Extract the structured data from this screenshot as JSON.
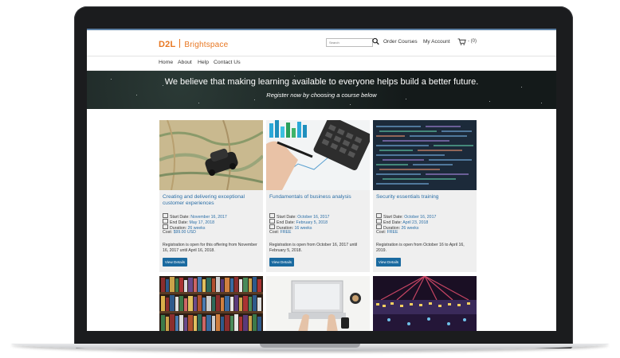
{
  "header": {
    "logo_mark": "D2L",
    "logo_name": "Brightspace",
    "search_placeholder": "Search",
    "order_courses": "Order Courses",
    "my_account": "My Account",
    "cart_count": "- (0)"
  },
  "subnav": {
    "items": [
      "Home",
      "About",
      "Help",
      "Contact Us"
    ]
  },
  "hero": {
    "title": "We believe that making learning available to everyone helps build a better future.",
    "subtitle": "Register now by choosing a course below"
  },
  "cards": [
    {
      "title": "Creating and delivering exceptional customer experiences",
      "start_label": "Start Date:",
      "start": "November 16, 2017",
      "end_label": "End Date:",
      "end": "May 17, 2018",
      "duration_label": "Duration:",
      "duration": "26 weeks",
      "cost_label": "Cost:",
      "cost": "$99.00 USD",
      "registration": "Registration is open for this offering from November 16, 2017 until April 16, 2018.",
      "button": "View Details"
    },
    {
      "title": "Fundamentals of business analysis",
      "start_label": "Start Date:",
      "start": "October 16, 2017",
      "end_label": "End Date:",
      "end": "February 5, 2018",
      "duration_label": "Duration:",
      "duration": "16 weeks",
      "cost_label": "Cost:",
      "cost": "FREE",
      "registration": "Registration is open from October 16, 2017 until February 5, 2018.",
      "button": "View Details"
    },
    {
      "title": "Security essentials training",
      "start_label": "Start Date:",
      "start": "October 16, 2017",
      "end_label": "End Date:",
      "end": "April 23, 2018",
      "duration_label": "Duration:",
      "duration": "26 weeks",
      "cost_label": "Cost:",
      "cost": "FREE",
      "registration": "Registration is open from October 16 to April 16, 2019.",
      "button": "View Details"
    }
  ],
  "colors": {
    "brand_orange": "#e87722",
    "link_blue": "#2a6ea6",
    "button_blue": "#1a6aa0",
    "hero_bg": "#141a1a",
    "card_bg": "#efefef"
  }
}
